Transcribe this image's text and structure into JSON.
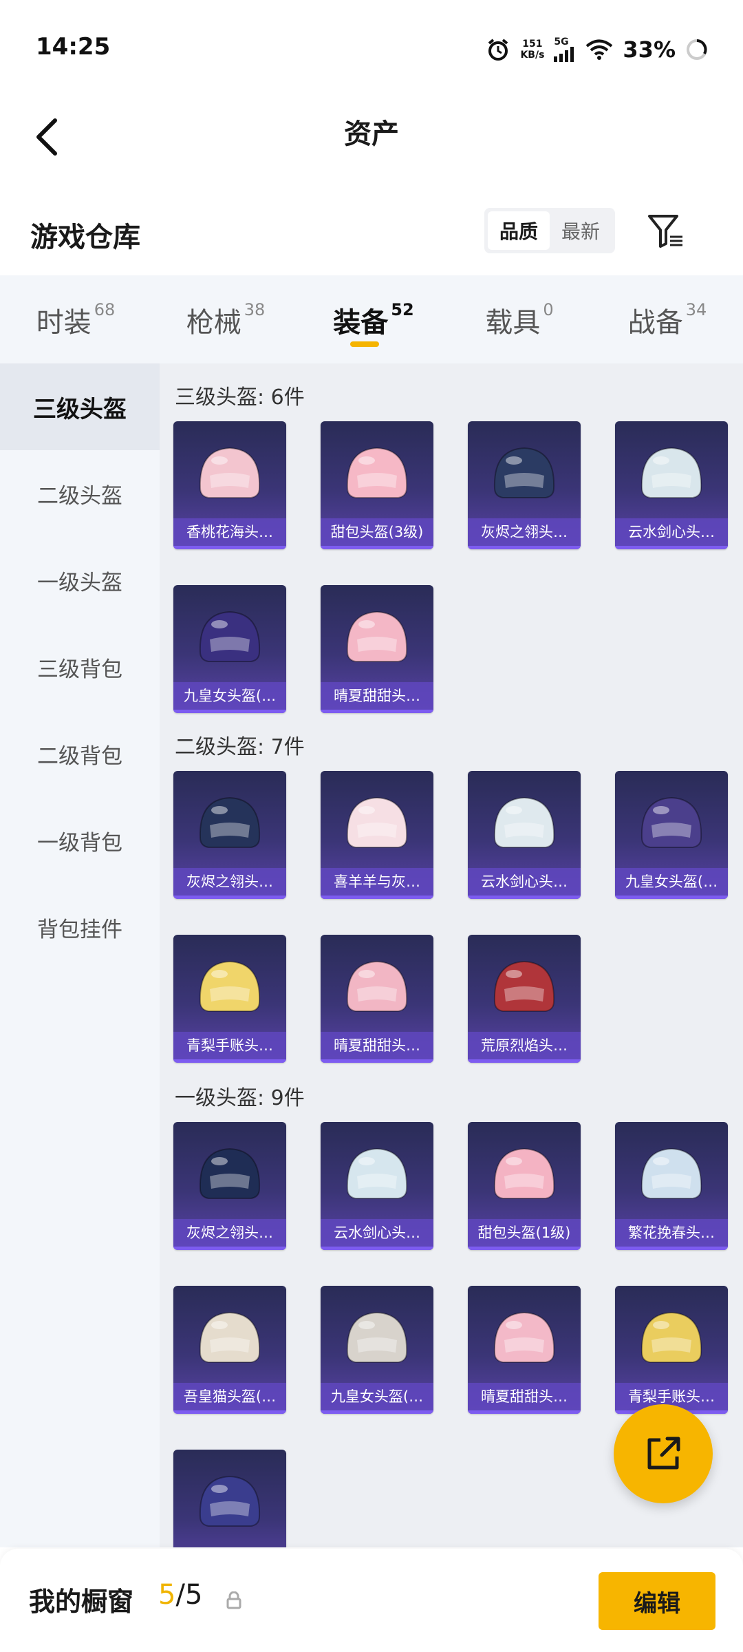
{
  "status_bar": {
    "time": "14:25",
    "net_speed_value": "151",
    "net_speed_unit": "KB/s",
    "network": "5G",
    "battery": "33%",
    "icons": [
      "alarm-icon",
      "signal-icon",
      "wifi-icon",
      "battery-icon"
    ]
  },
  "header": {
    "title": "资产",
    "back_icon": "chevron-left-icon"
  },
  "section": {
    "title": "游戏仓库",
    "sort_options": [
      "品质",
      "最新"
    ],
    "sort_selected": "品质",
    "filter_icon": "filter-icon"
  },
  "tabs": [
    {
      "name": "时装",
      "count": "68"
    },
    {
      "name": "枪械",
      "count": "38"
    },
    {
      "name": "装备",
      "count": "52",
      "active": true
    },
    {
      "name": "载具",
      "count": "0"
    },
    {
      "name": "战备",
      "count": "34"
    }
  ],
  "sidebar": [
    {
      "label": "三级头盔",
      "active": true
    },
    {
      "label": "二级头盔"
    },
    {
      "label": "一级头盔"
    },
    {
      "label": "三级背包"
    },
    {
      "label": "二级背包"
    },
    {
      "label": "一级背包"
    },
    {
      "label": "背包挂件"
    }
  ],
  "groups": [
    {
      "title": "三级头盔: 6件",
      "items": [
        {
          "name": "香桃花海头…",
          "color": "#f3c5cf"
        },
        {
          "name": "甜包头盔(3级)",
          "color": "#f6b8c6"
        },
        {
          "name": "灰烬之翎头…",
          "color": "#2b3b63"
        },
        {
          "name": "云水剑心头…",
          "color": "#d9e6ec"
        },
        {
          "name": "九皇女头盔(…",
          "color": "#3a3080"
        },
        {
          "name": "晴夏甜甜头…",
          "color": "#f4b7c6"
        }
      ]
    },
    {
      "title": "二级头盔: 7件",
      "items": [
        {
          "name": "灰烬之翎头…",
          "color": "#25335a"
        },
        {
          "name": "喜羊羊与灰…",
          "color": "#f6dfe4"
        },
        {
          "name": "云水剑心头…",
          "color": "#dfe9ee"
        },
        {
          "name": "九皇女头盔(…",
          "color": "#4b3f8c"
        },
        {
          "name": "青梨手账头…",
          "color": "#f0d56a"
        },
        {
          "name": "晴夏甜甜头…",
          "color": "#f2b6c4"
        },
        {
          "name": "荒原烈焰头…",
          "color": "#b0353a"
        }
      ]
    },
    {
      "title": "一级头盔: 9件",
      "items": [
        {
          "name": "灰烬之翎头…",
          "color": "#1f2d55"
        },
        {
          "name": "云水剑心头…",
          "color": "#d6e6ee"
        },
        {
          "name": "甜包头盔(1级)",
          "color": "#f4b3c3"
        },
        {
          "name": "繁花挽春头…",
          "color": "#cfe0ee"
        },
        {
          "name": "吾皇猫头盔(…",
          "color": "#e5dccd"
        },
        {
          "name": "九皇女头盔(…",
          "color": "#d8d3cc"
        },
        {
          "name": "晴夏甜甜头…",
          "color": "#f3b9c8"
        },
        {
          "name": "青梨手账头…",
          "color": "#eacd5e"
        },
        {
          "name": "",
          "color": "#3a3d8e"
        }
      ]
    }
  ],
  "fab": {
    "icon": "share-icon"
  },
  "bottom_bar": {
    "label": "我的橱窗",
    "current": "5",
    "separator": "/",
    "total": "5",
    "lock_icon": "lock-icon",
    "edit_label": "编辑"
  },
  "colors": {
    "accent": "#f7b500",
    "card_bottom": "#5a43a8"
  }
}
